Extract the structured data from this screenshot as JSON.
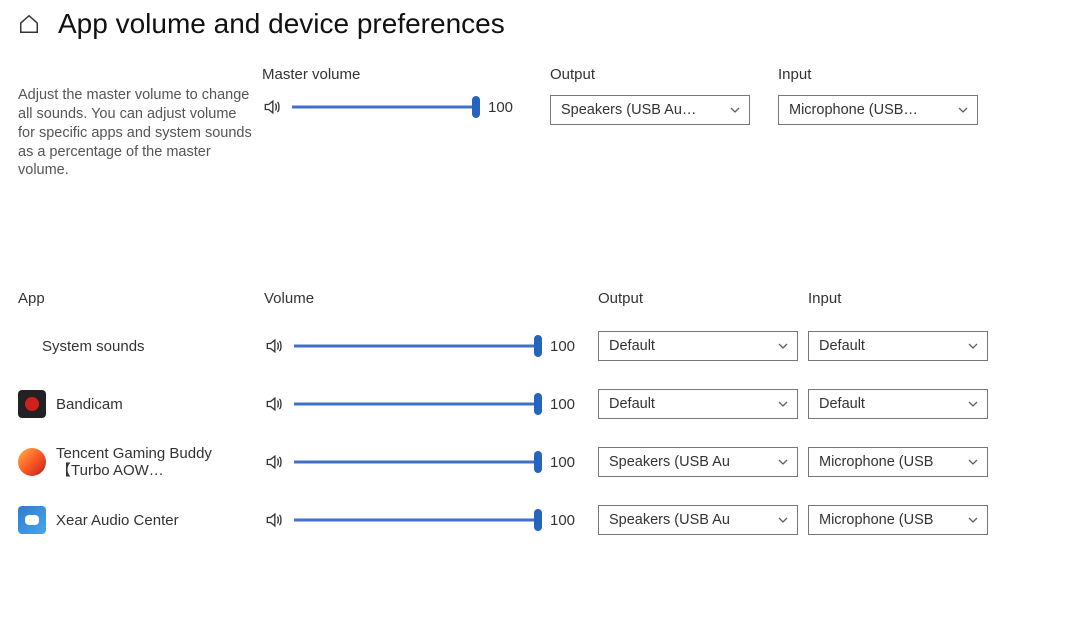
{
  "page_title": "App volume and device preferences",
  "help_text": "Adjust the master volume to change all sounds. You can adjust volume for specific apps and system sounds as a percentage of the master volume.",
  "headers": {
    "master_volume": "Master volume",
    "output": "Output",
    "input": "Input",
    "app": "App",
    "volume": "Volume"
  },
  "master": {
    "volume": "100",
    "output": "Speakers (USB Au…",
    "input": "Microphone (USB…"
  },
  "apps": [
    {
      "name": "System sounds",
      "volume": "100",
      "output": "Default",
      "input": "Default"
    },
    {
      "name": "Bandicam",
      "volume": "100",
      "output": "Default",
      "input": "Default"
    },
    {
      "name": "Tencent Gaming Buddy【Turbo AOW…",
      "volume": "100",
      "output": "Speakers (USB Au",
      "input": "Microphone (USB"
    },
    {
      "name": "Xear Audio Center",
      "volume": "100",
      "output": "Speakers (USB Au",
      "input": "Microphone (USB"
    }
  ]
}
